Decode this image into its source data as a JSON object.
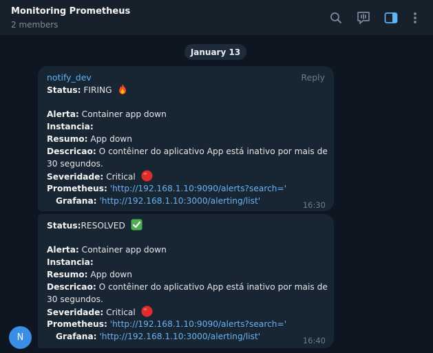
{
  "header": {
    "title": "Monitoring Prometheus",
    "subtitle": "2 members"
  },
  "date_separator": "January 13",
  "messages": [
    {
      "sender": "notify_dev",
      "reply_label": "Reply",
      "status_label": "Status:",
      "status_value": " FIRING",
      "status_emoji": "fire-icon",
      "alerta_label": "Alerta:",
      "alerta_value": " Container app down",
      "instancia_label": "Instancia:",
      "resumo_label": "Resumo:",
      "resumo_value": " App down",
      "descricao_label": "Descricao:",
      "descricao_value_1": " O contêiner do aplicativo App está inativo por mais de",
      "descricao_value_2": "30 segundos.",
      "severidade_label": "Severidade:",
      "severidade_value": " Critical",
      "severidade_emoji": "red-circle-icon",
      "prometheus_label": "Prometheus:",
      "prometheus_value": "'http://192.168.1.10:9090/alerts?search='",
      "grafana_label": "Grafana:",
      "grafana_value": "'http://192.168.1.10:3000/alerting/list'",
      "time": "16:30"
    },
    {
      "status_label": "Status:",
      "status_value": "RESOLVED",
      "status_emoji": "check-mark-icon",
      "alerta_label": "Alerta:",
      "alerta_value": " Container app down",
      "instancia_label": "Instancia:",
      "resumo_label": "Resumo:",
      "resumo_value": " App down",
      "descricao_label": "Descricao:",
      "descricao_value_1": " O contêiner do aplicativo App está inativo por mais de",
      "descricao_value_2": "30 segundos.",
      "severidade_label": "Severidade:",
      "severidade_value": " Critical",
      "severidade_emoji": "red-circle-icon",
      "prometheus_label": "Prometheus:",
      "prometheus_value": "'http://192.168.1.10:9090/alerts?search='",
      "grafana_label": "Grafana:",
      "grafana_value": "'http://192.168.1.10:3000/alerting/list'",
      "time": "16:40"
    }
  ],
  "avatar_initial": "N",
  "colors": {
    "background": "#0e1621",
    "header": "#17212b",
    "bubble": "#182533",
    "link": "#6ab3f3",
    "accent": "#5eb5f7",
    "avatar": "#3a8ee6"
  }
}
